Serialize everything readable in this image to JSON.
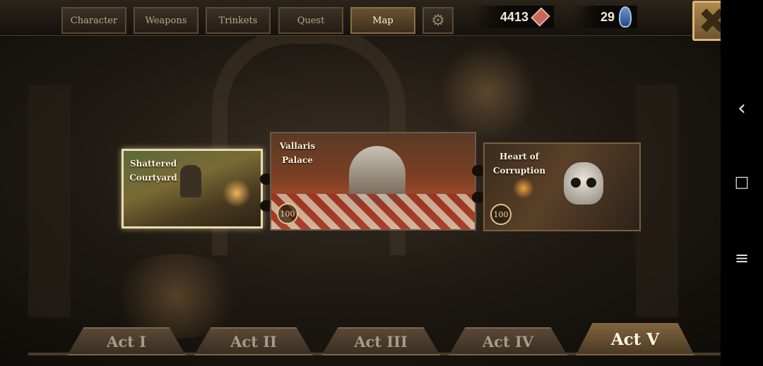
{
  "tabs": [
    {
      "label": "Character"
    },
    {
      "label": "Weapons"
    },
    {
      "label": "Trinkets"
    },
    {
      "label": "Quest"
    },
    {
      "label": "Map",
      "active": true
    }
  ],
  "settings_icon": "gear-icon",
  "currency": {
    "gold": {
      "value": "4413",
      "icon": "red-crystal-icon"
    },
    "gems": {
      "value": "29",
      "icon": "blue-gem-icon"
    }
  },
  "close_icon": "close-x-icon",
  "map": {
    "locations": [
      {
        "title_line1": "Shattered",
        "title_line2": "Courtyard"
      },
      {
        "title_line1": "Vallaris",
        "title_line2": "Palace",
        "level": "100"
      },
      {
        "title_line1": "Heart of",
        "title_line2": "Corruption",
        "level": "100"
      }
    ]
  },
  "acts": [
    {
      "label": "Act I"
    },
    {
      "label": "Act II"
    },
    {
      "label": "Act III"
    },
    {
      "label": "Act IV"
    },
    {
      "label": "Act V",
      "active": true
    }
  ],
  "system_nav": {
    "back": "‹",
    "home": "□",
    "menu": "≡"
  },
  "colors": {
    "accent_gold": "#d8b676",
    "active_tab": "#6a5230",
    "text_light": "#fff3dc"
  }
}
